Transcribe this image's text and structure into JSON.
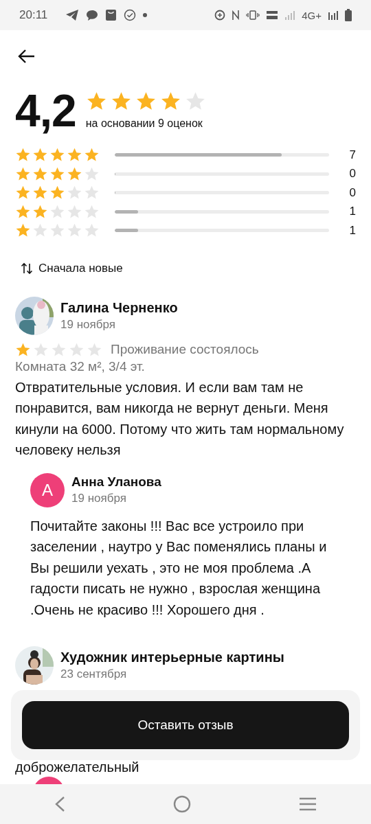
{
  "status_bar": {
    "time": "20:11",
    "network": "4G+"
  },
  "summary": {
    "rating": "4,2",
    "stars": 4,
    "basis": "на основании 9 оценок"
  },
  "histogram": [
    {
      "stars": 5,
      "level": 0.78,
      "count": "7"
    },
    {
      "stars": 4,
      "level": 0,
      "count": "0"
    },
    {
      "stars": 3,
      "level": 0,
      "count": "0"
    },
    {
      "stars": 2,
      "level": 0.11,
      "count": "1"
    },
    {
      "stars": 1,
      "level": 0.11,
      "count": "1"
    }
  ],
  "sort": {
    "label": "Сначала новые"
  },
  "reviews": [
    {
      "author": "Галина Черненко",
      "date": "19 ноября",
      "stars": 1,
      "status": "Проживание состоялось",
      "room": "Комната 32 м², 3/4 эт.",
      "text": "Отвратительные условия. И если вам там не понравится, вам никогда не вернут деньги. Меня кинули на 6000. Потому что жить там нормальному человеку нельзя",
      "replies": [
        {
          "initial": "А",
          "color": "#ee3f78",
          "author": "Анна Уланова",
          "date": "19 ноября",
          "text": "Почитайте законы !!! Вас все устроило при заселении , наутро у Вас поменялись планы и Вы решили уехать , это не моя проблема .А гадости писать не нужно , взрослая женщина .Очень не красиво !!! Хорошего дня ."
        }
      ]
    },
    {
      "author": "Художник интерьерные картины",
      "date": "23 сентября",
      "text": "доброжелательный"
    },
    {
      "kind": "letter",
      "color": "#ee3f78"
    }
  ],
  "action": {
    "label": "Оставить отзыв"
  }
}
